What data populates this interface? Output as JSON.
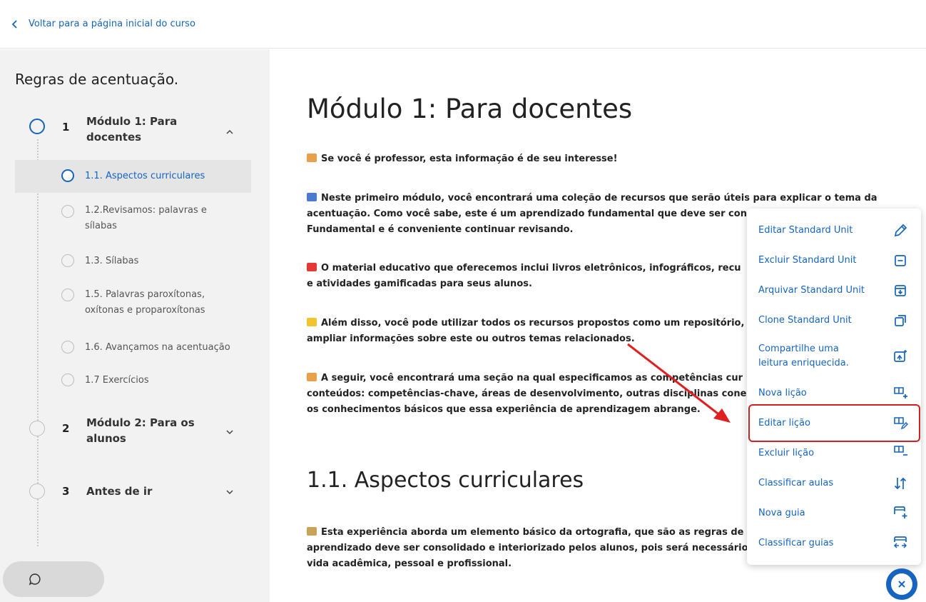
{
  "header": {
    "back_link": "Voltar para a página inicial do curso"
  },
  "sidebar": {
    "course_title": "Regras de acentuação.",
    "modules": [
      {
        "number": "1",
        "title_line1": "Módulo 1: Para",
        "title_line2": "docentes"
      },
      {
        "number": "2",
        "title_line1": "Módulo 2: Para os",
        "title_line2": "alunos"
      },
      {
        "number": "3",
        "title_line1": "Antes de ir",
        "title_line2": ""
      }
    ],
    "lessons": [
      {
        "line1": "1.1. Aspectos curriculares",
        "line2": ""
      },
      {
        "line1": "1.2.Revisamos: palavras e",
        "line2": "sílabas"
      },
      {
        "line1": "1.3. Sílabas",
        "line2": ""
      },
      {
        "line1": "1.5. Palavras paroxítonas,",
        "line2": "oxítonas e proparoxítonas"
      },
      {
        "line1": "1.6. Avançamos na acentuação",
        "line2": ""
      },
      {
        "line1": "1.7 Exercícios",
        "line2": ""
      }
    ]
  },
  "main": {
    "title": "Módulo 1: Para docentes",
    "paragraphs": [
      {
        "lines": [
          "Se você é professor, esta informação é de seu interesse!"
        ]
      },
      {
        "lines": [
          "Neste primeiro módulo, você encontrará uma coleção de recursos que serão úteis para explicar o tema da",
          "acentuação. Como você sabe, este é um aprendizado fundamental que deve ser con",
          "Fundamental e é conveniente continuar revisando."
        ]
      },
      {
        "lines": [
          "O material educativo que oferecemos inclui livros eletrônicos, infográficos, recu",
          "e atividades gamificadas para seus alunos."
        ]
      },
      {
        "lines": [
          "Além disso, você pode utilizar todos os recursos propostos como um repositório,",
          "ampliar informações sobre este ou outros temas relacionados."
        ]
      },
      {
        "lines": [
          "A seguir, você encontrará uma seção na qual especificamos as competências cur",
          "conteúdos: competências-chave, áreas de desenvolvimento, outras disciplinas cone",
          "os conhecimentos básicos que essa experiência de aprendizagem abrange."
        ]
      }
    ],
    "section_title": "1.1. Aspectos curriculares",
    "section_paragraph": {
      "lines": [
        "Esta experiência aborda um elemento básico da ortografia, que são as regras de",
        "aprendizado deve ser consolidado e interiorizado pelos alunos, pois será necessário",
        "vida acadêmica, pessoal e profissional."
      ]
    }
  },
  "menu": {
    "items": [
      {
        "label_line1": "Editar Standard Unit",
        "label_line2": "",
        "icon": "pencil-icon"
      },
      {
        "label_line1": "Excluir Standard Unit",
        "label_line2": "",
        "icon": "minus-box-icon"
      },
      {
        "label_line1": "Arquivar Standard Unit",
        "label_line2": "",
        "icon": "archive-icon"
      },
      {
        "label_line1": "Clone Standard Unit",
        "label_line2": "",
        "icon": "copy-icon"
      },
      {
        "label_line1": "Compartilhe uma",
        "label_line2": "leitura enriquecida.",
        "icon": "share-image-icon"
      },
      {
        "label_line1": "Nova lição",
        "label_line2": "",
        "icon": "book-plus-icon"
      },
      {
        "label_line1": "Editar lição",
        "label_line2": "",
        "icon": "book-edit-icon"
      },
      {
        "label_line1": "Excluir lição",
        "label_line2": "",
        "icon": "book-minus-icon"
      },
      {
        "label_line1": "Classificar aulas",
        "label_line2": "",
        "icon": "sort-icon"
      },
      {
        "label_line1": "Nova guia",
        "label_line2": "",
        "icon": "tab-plus-icon"
      },
      {
        "label_line1": "Classificar guias",
        "label_line2": "",
        "icon": "tab-sort-icon"
      }
    ]
  },
  "colors": {
    "accent": "#1565c0",
    "highlight": "#d32020",
    "sidebar_bg": "#f2f2f2"
  }
}
